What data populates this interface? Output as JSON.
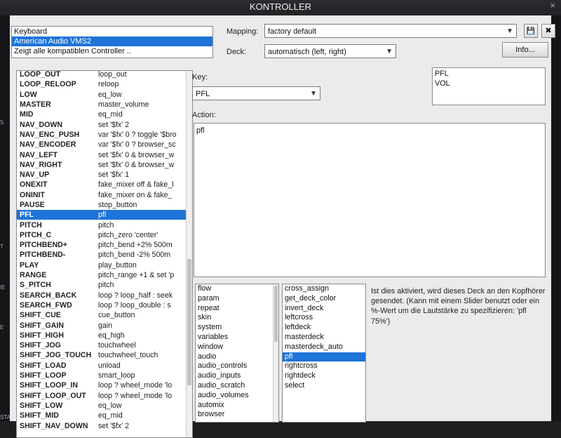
{
  "window": {
    "title": "KONTROLLER",
    "close_glyph": "×"
  },
  "side_letters": [
    "S",
    "T",
    "IE",
    "E",
    "STA"
  ],
  "controller_list": {
    "items": [
      "Keyboard",
      "American Audio VMS2",
      "Zeigt alle kompatiblen Controller .."
    ],
    "selected_index": 1
  },
  "mapping": {
    "label": "Mapping:",
    "value": "factory default",
    "save_glyph": "💾",
    "delete_glyph": "✖"
  },
  "deck": {
    "label": "Deck:",
    "value": "automatisch (left, right)"
  },
  "info_button": "Info...",
  "commands": {
    "rows": [
      [
        "LOOP_OUT",
        "loop_out"
      ],
      [
        "LOOP_RELOOP",
        "reloop"
      ],
      [
        "LOW",
        "eq_low"
      ],
      [
        "MASTER",
        "master_volume"
      ],
      [
        "MID",
        "eq_mid"
      ],
      [
        "NAV_DOWN",
        "set '$fx' 2"
      ],
      [
        "NAV_ENC_PUSH",
        "var '$fx' 0 ? toggle '$bro"
      ],
      [
        "NAV_ENCODER",
        "var '$fx' 0 ? browser_sc"
      ],
      [
        "NAV_LEFT",
        "set '$fx' 0 & browser_w"
      ],
      [
        "NAV_RIGHT",
        "set '$fx' 0 & browser_w"
      ],
      [
        "NAV_UP",
        "set '$fx' 1"
      ],
      [
        "ONEXIT",
        "fake_mixer off & fake_l"
      ],
      [
        "ONINIT",
        "fake_mixer on & fake_"
      ],
      [
        "PAUSE",
        "stop_button"
      ],
      [
        "PFL",
        "pfl"
      ],
      [
        "PITCH",
        "pitch"
      ],
      [
        "PITCH_C",
        "pitch_zero 'center'"
      ],
      [
        "PITCHBEND+",
        "pitch_bend +2% 500m"
      ],
      [
        "PITCHBEND-",
        "pitch_bend -2% 500m"
      ],
      [
        "PLAY",
        "play_button"
      ],
      [
        "RANGE",
        "pitch_range +1 & set 'p"
      ],
      [
        "S_PITCH",
        "pitch"
      ],
      [
        "SEARCH_BACK",
        "loop ? loop_half : seek"
      ],
      [
        "SEARCH_FWD",
        "loop ? loop_double : s"
      ],
      [
        "SHIFT_CUE",
        "cue_button"
      ],
      [
        "SHIFT_GAIN",
        "gain"
      ],
      [
        "SHIFT_HIGH",
        "eq_high"
      ],
      [
        "SHIFT_JOG",
        "touchwheel"
      ],
      [
        "SHIFT_JOG_TOUCH",
        "touchwheel_touch"
      ],
      [
        "SHIFT_LOAD",
        "unload"
      ],
      [
        "SHIFT_LOOP",
        "smart_loop"
      ],
      [
        "SHIFT_LOOP_IN",
        "loop ? wheel_mode 'lo"
      ],
      [
        "SHIFT_LOOP_OUT",
        "loop ? wheel_mode 'lo"
      ],
      [
        "SHIFT_LOW",
        "eq_low"
      ],
      [
        "SHIFT_MID",
        "eq_mid"
      ],
      [
        "SHIFT_NAV_DOWN",
        "set '$fx' 2"
      ]
    ],
    "selected_index": 14,
    "scroll_fraction": 0.55
  },
  "key": {
    "label": "Key:",
    "value": "PFL"
  },
  "action": {
    "label": "Action:",
    "value": "pfl"
  },
  "key_list": {
    "items": [
      "PFL",
      "VOL"
    ]
  },
  "categories": {
    "items": [
      "flow",
      "param",
      "repeat",
      "skin",
      "system",
      "variables",
      "window",
      "audio",
      "audio_controls",
      "audio_inputs",
      "audio_scratch",
      "audio_volumes",
      "automix",
      "browser"
    ]
  },
  "verbs": {
    "items": [
      "cross_assign",
      "get_deck_color",
      "invert_deck",
      "leftcross",
      "leftdeck",
      "masterdeck",
      "masterdeck_auto",
      "pfl",
      "rightcross",
      "rightdeck",
      "select"
    ],
    "selected_index": 7
  },
  "description": "Ist dies aktiviert, wird dieses Deck an den Kopfhörer gesendet. (Kann mit einem Slider benutzt oder ein %-Wert um die Lautstärke zu spezifizieren: 'pfl 75%')",
  "colors": {
    "selection": "#1e74d8",
    "dialog_bg": "#ebebeb",
    "titlebar": "#2a2a2d"
  }
}
